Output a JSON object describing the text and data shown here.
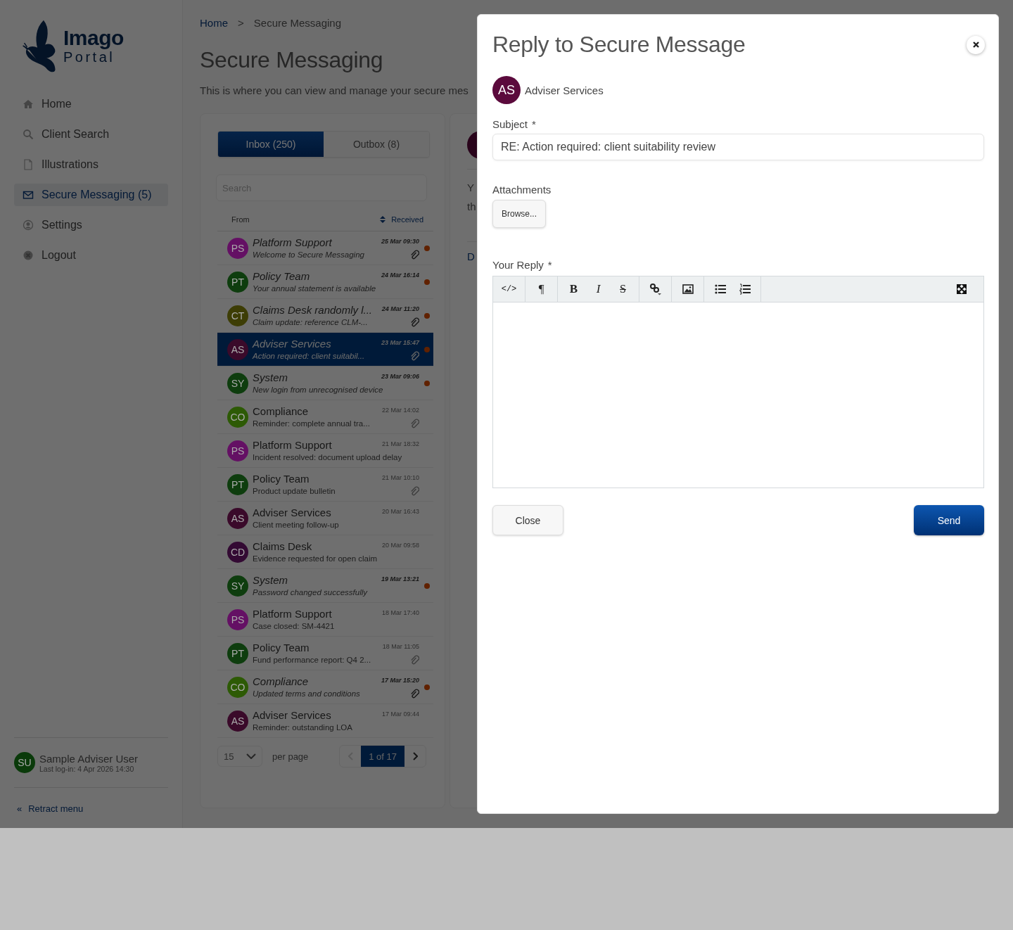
{
  "sidebar": {
    "logo": {
      "title": "Imago",
      "subtitle": "Portal"
    },
    "items": [
      {
        "label": "Home",
        "kind": "home",
        "selected": false
      },
      {
        "label": "Client Search",
        "kind": "search",
        "selected": false
      },
      {
        "label": "Illustrations",
        "kind": "file",
        "selected": false
      },
      {
        "label": "Secure Messaging (5)",
        "kind": "envelope",
        "selected": true
      },
      {
        "label": "Settings",
        "kind": "user",
        "selected": false
      },
      {
        "label": "Logout",
        "kind": "close",
        "selected": false
      }
    ],
    "user": {
      "initials": "SU",
      "color": "#0a3a0a",
      "name": "Sample Adviser User",
      "last_login": "Last log-in: 4 Apr 2026 14:30"
    },
    "retract": {
      "icon": "«",
      "label": "Retract menu"
    }
  },
  "breadcrumb": {
    "items": [
      "Home",
      "Secure Messaging"
    ],
    "separator": ">"
  },
  "page": {
    "title": "Secure Messaging",
    "intro": "This is where you can view and manage your secure mes"
  },
  "tabs": [
    {
      "label": "Inbox (250)",
      "selected": true
    },
    {
      "label": "Outbox (8)",
      "selected": false
    }
  ],
  "search": {
    "placeholder": "Search"
  },
  "columns": {
    "from": "From",
    "received": "Received"
  },
  "messages": [
    {
      "initials": "PS",
      "color": "#641064",
      "from": "Platform Support",
      "subject": "Welcome to Secure Messaging",
      "date": "25 Mar 09:30",
      "attachment": true,
      "unread": true,
      "selected": false
    },
    {
      "initials": "PT",
      "color": "#0e3d0e",
      "from": "Policy Team",
      "subject": "Your annual statement is available",
      "date": "24 Mar 16:14",
      "attachment": false,
      "unread": true,
      "selected": false
    },
    {
      "initials": "CT",
      "color": "#3d3d05",
      "from": "Claims Desk randomly l...",
      "subject": "Claim update: reference CLM-...",
      "date": "24 Mar 11:20",
      "attachment": true,
      "unread": true,
      "selected": false
    },
    {
      "initials": "AS",
      "color": "#3a0a2a",
      "from": "Adviser Services",
      "subject": "Action required: client suitabil...",
      "date": "23 Mar 15:47",
      "attachment": true,
      "unread": true,
      "selected": true
    },
    {
      "initials": "SY",
      "color": "#0e3d0e",
      "from": "System",
      "subject": "New login from unrecognised device",
      "date": "23 Mar 09:06",
      "attachment": false,
      "unread": true,
      "selected": false
    },
    {
      "initials": "CO",
      "color": "#2d5a05",
      "from": "Compliance",
      "subject": "Reminder: complete annual tra...",
      "date": "22 Mar 14:02",
      "attachment": true,
      "unread": false,
      "selected": false
    },
    {
      "initials": "PS",
      "color": "#641064",
      "from": "Platform Support",
      "subject": "Incident resolved: document upload delay",
      "date": "21 Mar 18:32",
      "attachment": false,
      "unread": false,
      "selected": false
    },
    {
      "initials": "PT",
      "color": "#0e3d0e",
      "from": "Policy Team",
      "subject": "Product update bulletin",
      "date": "21 Mar 10:10",
      "attachment": true,
      "unread": false,
      "selected": false
    },
    {
      "initials": "AS",
      "color": "#3a0a2a",
      "from": "Adviser Services",
      "subject": "Client meeting follow-up",
      "date": "20 Mar 16:43",
      "attachment": false,
      "unread": false,
      "selected": false
    },
    {
      "initials": "CD",
      "color": "#330a33",
      "from": "Claims Desk",
      "subject": "Evidence requested for open claim",
      "date": "20 Mar 09:58",
      "attachment": false,
      "unread": false,
      "selected": false
    },
    {
      "initials": "SY",
      "color": "#0e3d0e",
      "from": "System",
      "subject": "Password changed successfully",
      "date": "19 Mar 13:21",
      "attachment": false,
      "unread": true,
      "selected": false
    },
    {
      "initials": "PS",
      "color": "#641064",
      "from": "Platform Support",
      "subject": "Case closed: SM-4421",
      "date": "18 Mar 17:40",
      "attachment": false,
      "unread": false,
      "selected": false
    },
    {
      "initials": "PT",
      "color": "#0e3d0e",
      "from": "Policy Team",
      "subject": "Fund performance report: Q4 2...",
      "date": "18 Mar 11:05",
      "attachment": true,
      "unread": false,
      "selected": false
    },
    {
      "initials": "CO",
      "color": "#2d5a05",
      "from": "Compliance",
      "subject": "Updated terms and conditions",
      "date": "17 Mar 15:20",
      "attachment": true,
      "unread": true,
      "selected": false
    },
    {
      "initials": "AS",
      "color": "#3a0a2a",
      "from": "Adviser Services",
      "subject": "Reminder: outstanding LOA",
      "date": "17 Mar 09:44",
      "attachment": false,
      "unread": false,
      "selected": false
    }
  ],
  "pagination": {
    "per_page_value": "15",
    "per_page_label": "per page",
    "page": "1 of 17"
  },
  "preview": {
    "texts": [
      "Y",
      "th",
      "D"
    ]
  },
  "modal": {
    "title": "Reply to Secure Message",
    "recipient": {
      "initials": "AS",
      "name": "Adviser Services"
    },
    "subject": {
      "label": "Subject",
      "required_mark": "*",
      "value": "RE: Action required: client suitability review"
    },
    "attachments": {
      "label": "Attachments",
      "button": "Browse..."
    },
    "reply": {
      "label": "Your Reply",
      "required_mark": "*",
      "toolbar": [
        [
          {
            "kind": "code",
            "glyph": "</>"
          }
        ],
        [
          {
            "kind": "paragraph",
            "glyph": "¶"
          }
        ],
        [
          {
            "kind": "bold",
            "glyph": "B"
          },
          {
            "kind": "italic",
            "glyph": "I"
          },
          {
            "kind": "strikethrough",
            "glyph": "S"
          }
        ],
        [
          {
            "kind": "link"
          }
        ],
        [
          {
            "kind": "image"
          }
        ],
        [
          {
            "kind": "bullet-list"
          },
          {
            "kind": "numbered-list"
          }
        ]
      ]
    },
    "buttons": {
      "close": "Close",
      "send": "Send"
    }
  }
}
